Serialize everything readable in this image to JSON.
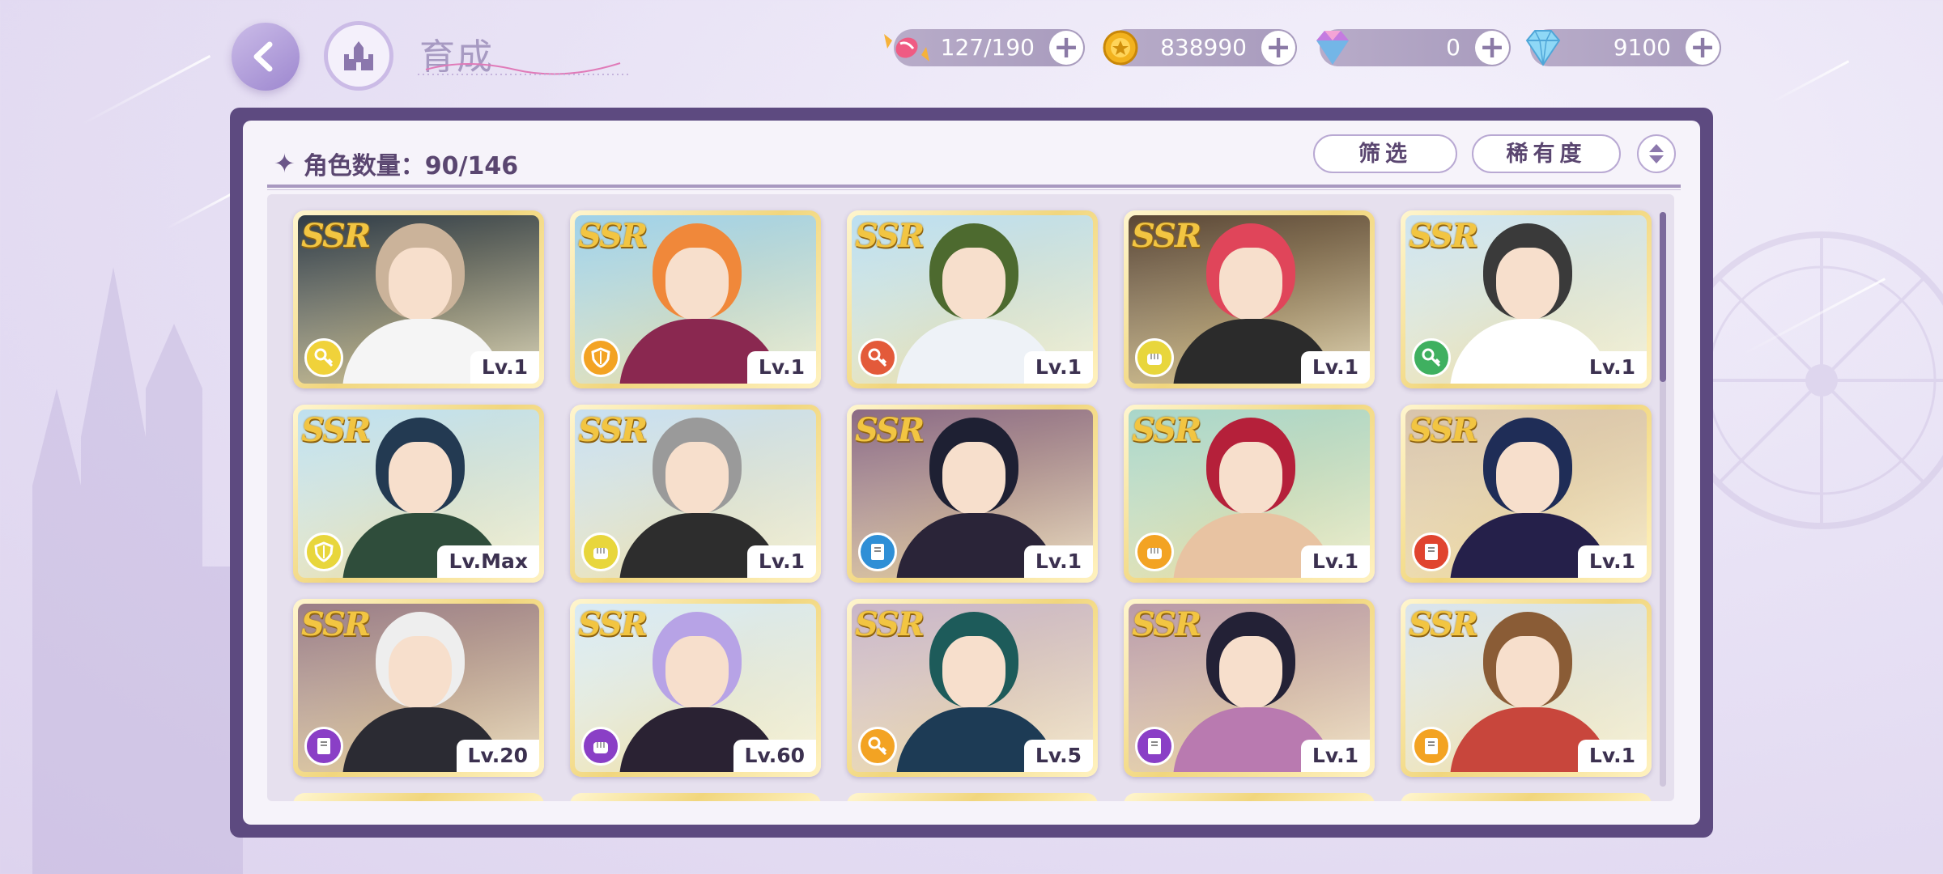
{
  "header": {
    "title": "育成",
    "resources": [
      {
        "name": "candy",
        "value": "127/190",
        "color": "#e9547a"
      },
      {
        "name": "gold-coin",
        "value": "838990",
        "color": "#f2b21e"
      },
      {
        "name": "rainbow-gem",
        "value": "0",
        "color": "#c47be0"
      },
      {
        "name": "diamond",
        "value": "9100",
        "color": "#6fc6f0"
      }
    ],
    "plus": "+"
  },
  "toolbar": {
    "count_label": "角色数量：90/146",
    "filter_label": "筛选",
    "rarity_label": "稀有度"
  },
  "characters": [
    {
      "rarity": "SSR",
      "level": "Lv.1",
      "role_icon": "key-icon",
      "role_color": "#f0d23a",
      "hair": "#cbb39a",
      "bg": "#2f3b45",
      "cloth": "#f5f5f5"
    },
    {
      "rarity": "SSR",
      "level": "Lv.1",
      "role_icon": "shield-icon",
      "role_color": "#f3a323",
      "hair": "#f0883a",
      "bg": "#9fd1e8",
      "cloth": "#8a2850"
    },
    {
      "rarity": "SSR",
      "level": "Lv.1",
      "role_icon": "key-icon",
      "role_color": "#e35a3a",
      "hair": "#4d6a2f",
      "bg": "#bcdff0",
      "cloth": "#eef2f7"
    },
    {
      "rarity": "SSR",
      "level": "Lv.1",
      "role_icon": "fist-icon",
      "role_color": "#e8d63c",
      "hair": "#e0455a",
      "bg": "#5a4634",
      "cloth": "#2b2b2b"
    },
    {
      "rarity": "SSR",
      "level": "Lv.1",
      "role_icon": "key-icon",
      "role_color": "#3fb060",
      "hair": "#3a3a3a",
      "bg": "#cde4f0",
      "cloth": "#ffffff"
    },
    {
      "rarity": "SSR",
      "level": "Lv.Max",
      "role_icon": "shield-icon",
      "role_color": "#e8d63c",
      "hair": "#233a52",
      "bg": "#bfe0ef",
      "cloth": "#2f4d3b"
    },
    {
      "rarity": "SSR",
      "level": "Lv.1",
      "role_icon": "fist-icon",
      "role_color": "#e8d63c",
      "hair": "#9a9a9a",
      "bg": "#c8dff0",
      "cloth": "#2d2d2d"
    },
    {
      "rarity": "SSR",
      "level": "Lv.1",
      "role_icon": "book-icon",
      "role_color": "#2f8fd6",
      "hair": "#1e2033",
      "bg": "#8b6a84",
      "cloth": "#2a2438"
    },
    {
      "rarity": "SSR",
      "level": "Lv.1",
      "role_icon": "fist-icon",
      "role_color": "#f3a323",
      "hair": "#b5203a",
      "bg": "#a9d6c9",
      "cloth": "#e8c3a2"
    },
    {
      "rarity": "SSR",
      "level": "Lv.1",
      "role_icon": "book-icon",
      "role_color": "#e0442f",
      "hair": "#1f2d57",
      "bg": "#d8c4ac",
      "cloth": "#25204a"
    },
    {
      "rarity": "SSR",
      "level": "Lv.20",
      "role_icon": "book-icon",
      "role_color": "#8a3fc6",
      "hair": "#eeeeee",
      "bg": "#9a7d86",
      "cloth": "#2b2b33"
    },
    {
      "rarity": "SSR",
      "level": "Lv.60",
      "role_icon": "fist-icon",
      "role_color": "#8a3fc6",
      "hair": "#b7a3e6",
      "bg": "#d8eaf4",
      "cloth": "#2a2233"
    },
    {
      "rarity": "SSR",
      "level": "Lv.5",
      "role_icon": "key-icon",
      "role_color": "#f3a323",
      "hair": "#1d5b5a",
      "bg": "#c9b6c8",
      "cloth": "#1d3b55"
    },
    {
      "rarity": "SSR",
      "level": "Lv.1",
      "role_icon": "book-icon",
      "role_color": "#8a3fc6",
      "hair": "#232136",
      "bg": "#b99aa7",
      "cloth": "#b97ab0"
    },
    {
      "rarity": "SSR",
      "level": "Lv.1",
      "role_icon": "book-icon",
      "role_color": "#f3a323",
      "hair": "#8a5c36",
      "bg": "#d9e4ec",
      "cloth": "#c8463c"
    }
  ]
}
